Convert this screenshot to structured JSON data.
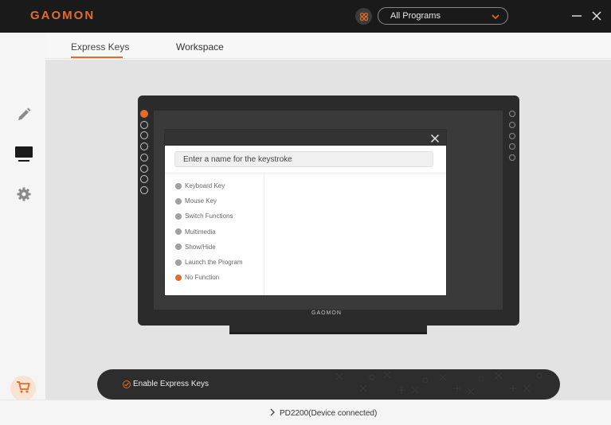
{
  "app": {
    "logo_text": "GAOMON",
    "brand_color": "#e36b2c"
  },
  "header": {
    "program_select_value": "All Programs"
  },
  "tabs": [
    {
      "label": "Express Keys",
      "active": true
    },
    {
      "label": "Workspace",
      "active": false
    }
  ],
  "sidebar": {
    "items": [
      {
        "icon": "pen-icon"
      },
      {
        "icon": "display-icon",
        "active": true
      },
      {
        "icon": "gear-icon"
      }
    ],
    "cart_icon": "cart-icon"
  },
  "tablet": {
    "logo_text": "GAOMON",
    "left_key_count": 8,
    "right_key_count": 5,
    "active_key_index": 0
  },
  "dialog": {
    "input_placeholder": "Enter a name for the keystroke",
    "options": [
      {
        "label": "Keyboard Key",
        "selected": false
      },
      {
        "label": "Mouse Key",
        "selected": false
      },
      {
        "label": "Switch Functions",
        "selected": false
      },
      {
        "label": "Multimedia",
        "selected": false
      },
      {
        "label": "Show/Hide",
        "selected": false
      },
      {
        "label": "Launch the Program",
        "selected": false
      },
      {
        "label": "No Function",
        "selected": true
      }
    ]
  },
  "enable": {
    "label": "Enable Express Keys",
    "checked": true
  },
  "footer": {
    "device": "PD2200(Device connected)"
  }
}
